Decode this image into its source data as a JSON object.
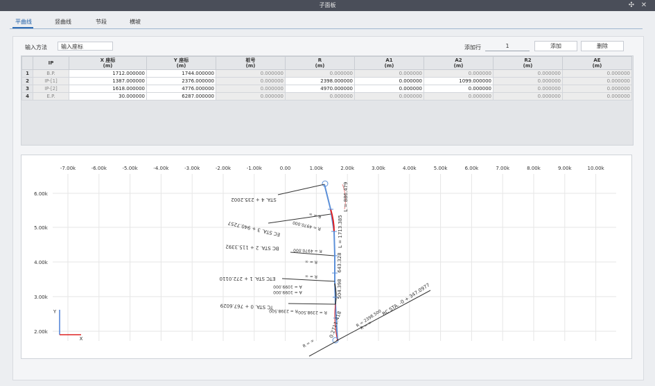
{
  "window": {
    "title": "子面板"
  },
  "tabs": [
    "平曲线",
    "竖曲线",
    "节段",
    "横坡"
  ],
  "toolbar": {
    "input_method_label": "输入方法",
    "input_method_value": "输入座标",
    "add_rows_label": "添加行",
    "add_rows_value": "1",
    "add_button": "添加",
    "delete_button": "删除"
  },
  "table": {
    "columns": [
      {
        "name": "IP",
        "unit": ""
      },
      {
        "name": "X 座标",
        "unit": "(m)"
      },
      {
        "name": "Y 座标",
        "unit": "(m)"
      },
      {
        "name": "桩号",
        "unit": "(m)"
      },
      {
        "name": "R",
        "unit": "(m)"
      },
      {
        "name": "A1",
        "unit": "(m)"
      },
      {
        "name": "A2",
        "unit": "(m)"
      },
      {
        "name": "R2",
        "unit": "(m)"
      },
      {
        "name": "AE",
        "unit": "(m)"
      }
    ],
    "rows": [
      {
        "n": "1",
        "ip": "B.P.",
        "x": "1712.000000",
        "y": "1744.000000",
        "sta": "0.000000",
        "r": "0.000000",
        "a1": "0.000000",
        "a2": "0.000000",
        "r2": "0.000000",
        "ae": "0.000000"
      },
      {
        "n": "2",
        "ip": "IP-[1]",
        "x": "1387.000000",
        "y": "2376.000000",
        "sta": "0.000000",
        "r": "2398.000000",
        "a1": "0.000000",
        "a2": "1099.000000",
        "r2": "0.000000",
        "ae": "0.000000"
      },
      {
        "n": "3",
        "ip": "IP-[2]",
        "x": "1618.000000",
        "y": "4776.000000",
        "sta": "0.000000",
        "r": "4970.000000",
        "a1": "0.000000",
        "a2": "0.000000",
        "r2": "0.000000",
        "ae": "0.000000"
      },
      {
        "n": "4",
        "ip": "E.P.",
        "x": "30.000000",
        "y": "6287.000000",
        "sta": "0.000000",
        "r": "0.000000",
        "a1": "0.000000",
        "a2": "0.000000",
        "r2": "0.000000",
        "ae": "0.000000"
      }
    ]
  },
  "plot": {
    "x_ticks": [
      "-7.00k",
      "-6.00k",
      "-5.00k",
      "-4.00k",
      "-3.00k",
      "-2.00k",
      "-1.00k",
      "0.00",
      "1.00k",
      "2.00k",
      "3.00k",
      "4.00k",
      "5.00k",
      "6.00k",
      "7.00k",
      "8.00k",
      "9.00k",
      "10.00k"
    ],
    "y_ticks": [
      "6.00k",
      "5.00k",
      "4.00k",
      "3.00k",
      "2.00k"
    ],
    "axis_x_label": "X",
    "axis_y_label": "Y",
    "labels": {
      "sta4": "STA. 4 + 235.2002",
      "ec3": "EC STA. 3 + 940.7257",
      "bc2": "BC STA. 2 + 115.3392",
      "etc1": "ETC STA. 1 + 272.0110",
      "tc0": "TC STA. 0 + 767.6029",
      "bc0": "BC STA. -0 + 347.0977",
      "r_inf": "R = ∞",
      "r4970": "R = 4970.000",
      "r2398": "R = 2398.500",
      "r2398b": "R = 2398.500",
      "a1099": "A = 1099.000",
      "l_top": "L = 886.479",
      "l_mid": "L = 1713.385",
      "l_a": "643.328",
      "l_b": "504.398",
      "l_c": "0.2711.418"
    },
    "colors": {
      "alignment": "#5b8fd8",
      "curve": "#e02020",
      "grid": "#e6e6e6"
    }
  }
}
